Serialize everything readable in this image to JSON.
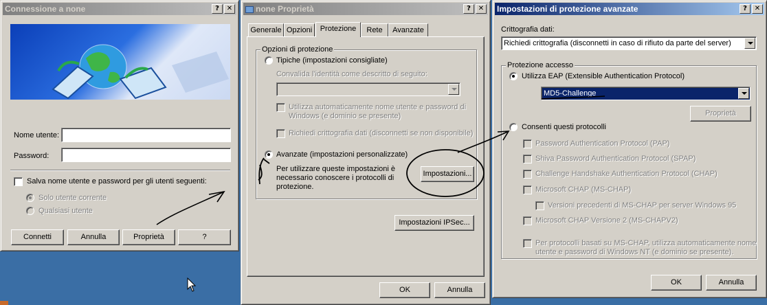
{
  "dlg1": {
    "title": "Connessione a none",
    "username_label": "Nome utente:",
    "password_label": "Password:",
    "save_label": "Salva nome utente e password per gli utenti seguenti:",
    "only_user": "Solo utente corrente",
    "any_user": "Qualsiasi utente",
    "buttons": [
      "Connetti",
      "Annulla",
      "Proprietà",
      "?"
    ]
  },
  "dlg2": {
    "title": "none Proprietà",
    "tabs": [
      "Generale",
      "Opzioni",
      "Protezione",
      "Rete",
      "Avanzate"
    ],
    "group_title": "Opzioni di protezione",
    "typical": "Tipiche (impostazioni consigliate)",
    "validate_label": "Convalida l'identità come descritto di seguito:",
    "auto_login_1": "Utilizza automaticamente nome utente e password di",
    "auto_login_2": "Windows (e dominio se presente)",
    "require_enc": "Richiedi crittografia dati (disconnetti se non disponibile)",
    "advanced": "Avanzate (impostazioni personalizzate)",
    "advanced_desc_1": "Per utilizzare queste impostazioni è",
    "advanced_desc_2": "necessario conoscere i protocolli di",
    "advanced_desc_3": "protezione.",
    "settings_button": "Impostazioni...",
    "ipsec_button": "Impostazioni IPSec...",
    "ok": "OK",
    "cancel": "Annulla"
  },
  "dlg3": {
    "title": "Impostazioni di protezione avanzate",
    "data_enc_label": "Crittografia dati:",
    "data_enc_value": "Richiedi crittografia (disconnetti in caso di rifiuto da parte del server)",
    "logon_group": "Protezione accesso",
    "use_eap": "Utilizza EAP (Extensible Authentication Protocol)",
    "eap_value": "MD5-Challenge",
    "properties": "Proprietà",
    "allow_protocols": "Consenti questi protocolli",
    "protocols": [
      "Password Authentication Protocol (PAP)",
      "Shiva Password Authentication Protocol (SPAP)",
      "Challenge Handshake Authentication Protocol (CHAP)",
      "Microsoft CHAP (MS-CHAP)",
      "Versioni precedenti di MS-CHAP per server Windows 95",
      "Microsoft CHAP Versione 2 (MS-CHAPV2)"
    ],
    "mschap_note_1": "Per protocolli basati su MS-CHAP, utilizza automaticamente nome",
    "mschap_note_2": "utente e password di Windows NT (e dominio se presente).",
    "ok": "OK",
    "cancel": "Annulla"
  }
}
